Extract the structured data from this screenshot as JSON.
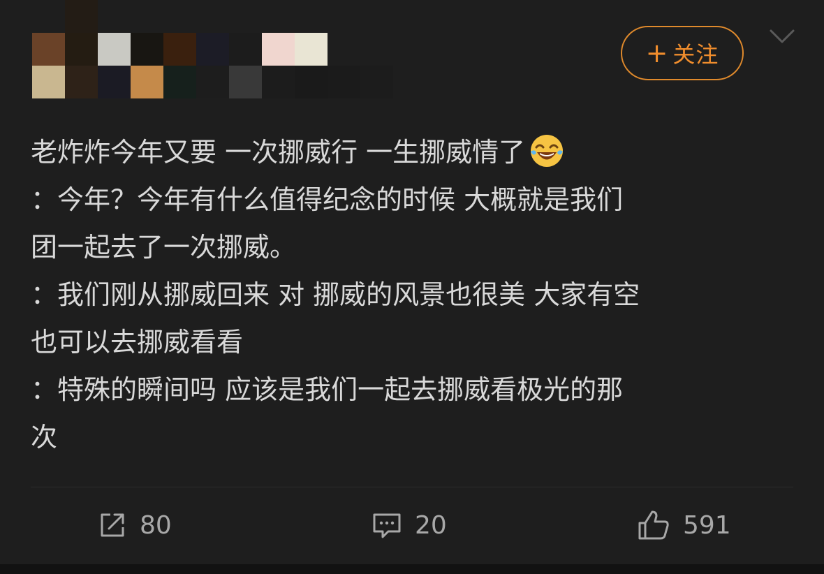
{
  "header": {
    "follow_label": "关注",
    "follow_icon": "plus-icon",
    "menu_icon": "chevron-down-icon",
    "accent_color": "#f08d2d"
  },
  "post": {
    "lines": [
      "老炸炸今年又要 一次挪威行 一生挪威情了",
      "：今年？今年有什么值得纪念的时候 大概就是我们",
      "团一起去了一次挪威。",
      "：我们刚从挪威回来 对 挪威的风景也很美 大家有空",
      "也可以去挪威看看",
      "：特殊的瞬间吗 应该是我们一起去挪威看极光的那",
      "次"
    ],
    "emoji": "laughing-crying-emoji"
  },
  "actions": {
    "repost": {
      "icon": "share-icon",
      "count": "80"
    },
    "comment": {
      "icon": "comment-icon",
      "count": "20"
    },
    "like": {
      "icon": "thumbs-up-icon",
      "count": "591"
    }
  }
}
